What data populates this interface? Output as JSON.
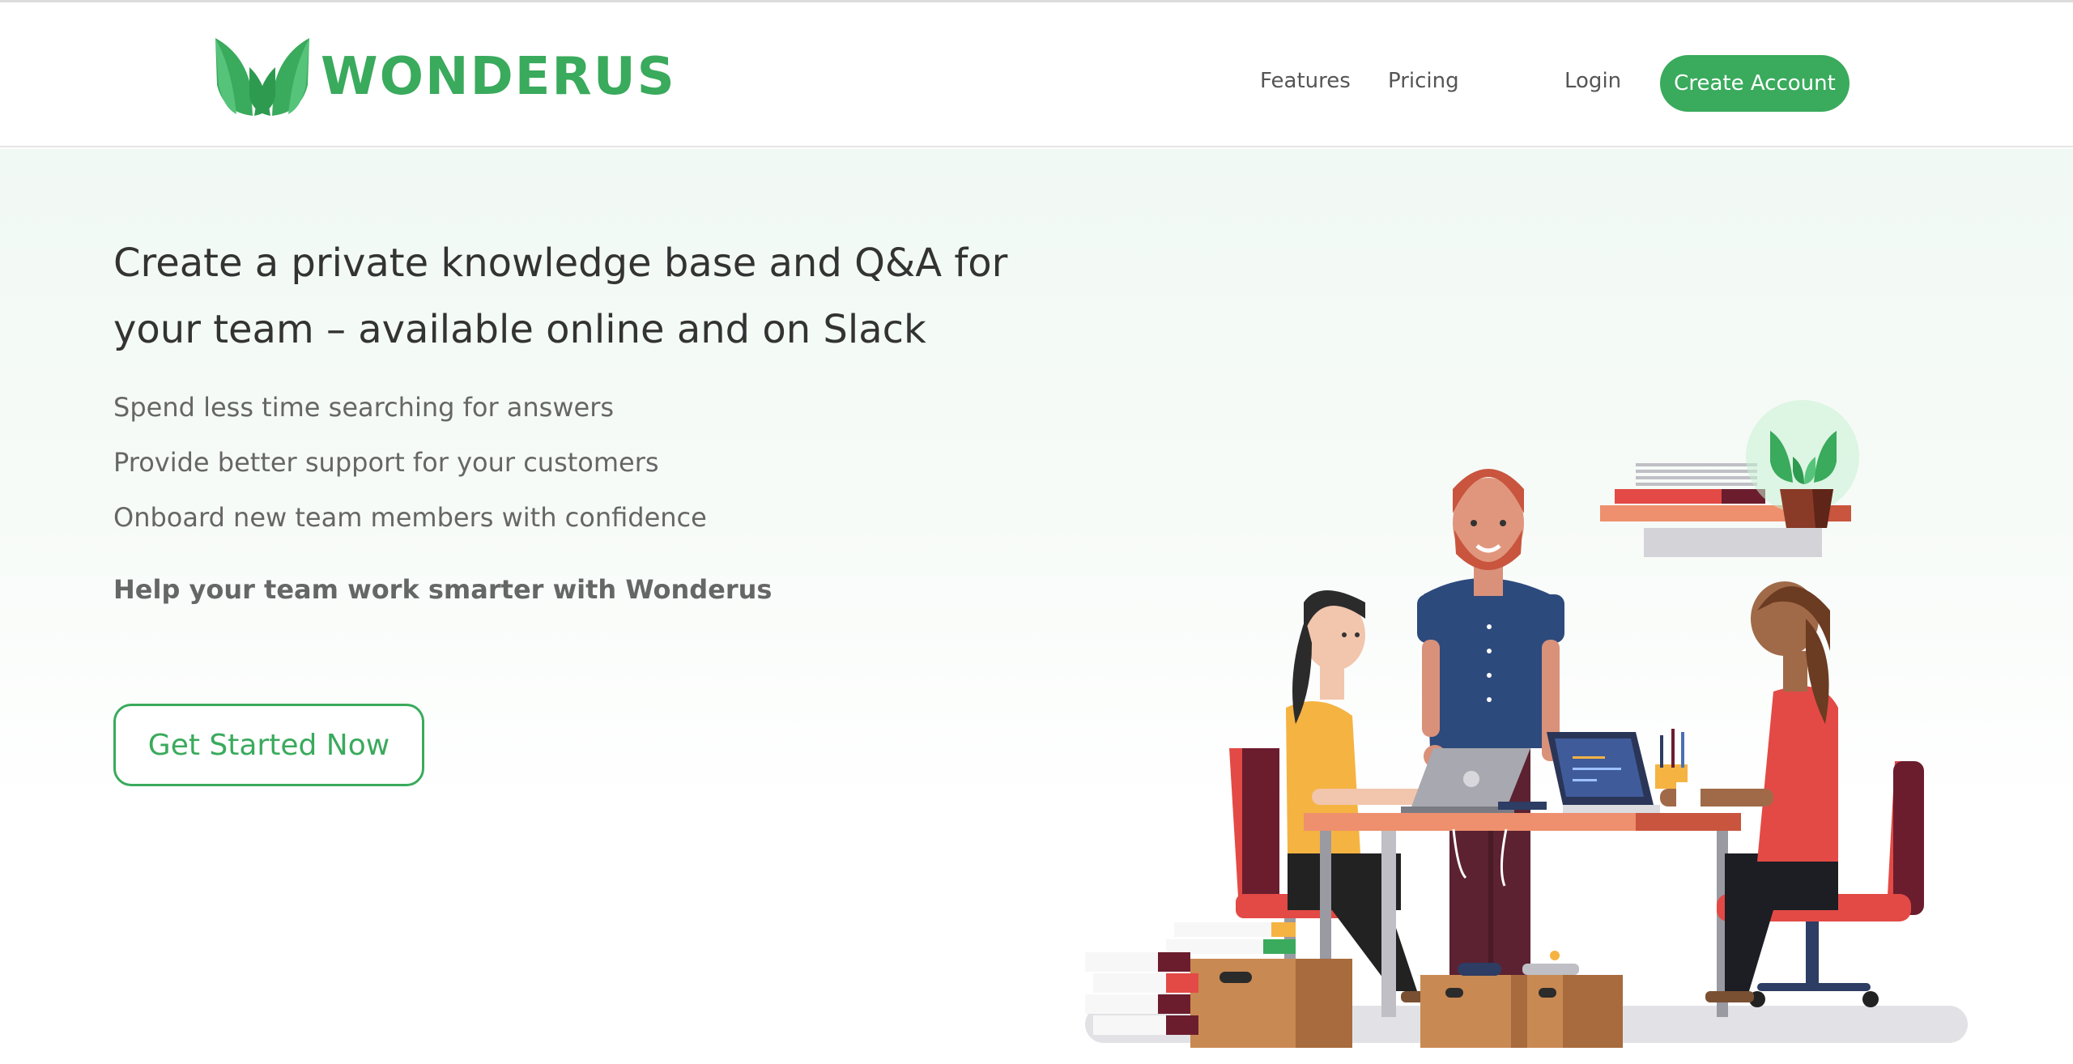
{
  "header": {
    "brand": "WONDERUS",
    "nav": {
      "features": "Features",
      "pricing": "Pricing",
      "login": "Login",
      "create_account": "Create Account"
    }
  },
  "hero": {
    "headline": "Create a private knowledge base and Q&A for your team – available online and on Slack",
    "bullets": [
      "Spend less time searching for answers",
      "Provide better support for your customers",
      "Onboard new team members with confidence"
    ],
    "tagline": "Help your team work smarter with Wonderus",
    "cta_label": "Get Started Now"
  },
  "colors": {
    "brand_green": "#3aaa5c",
    "text_dark": "#333333",
    "text_muted": "#666666"
  },
  "icons": {
    "logo": "leaf-logo-icon",
    "illustration": "team-meeting-illustration"
  }
}
